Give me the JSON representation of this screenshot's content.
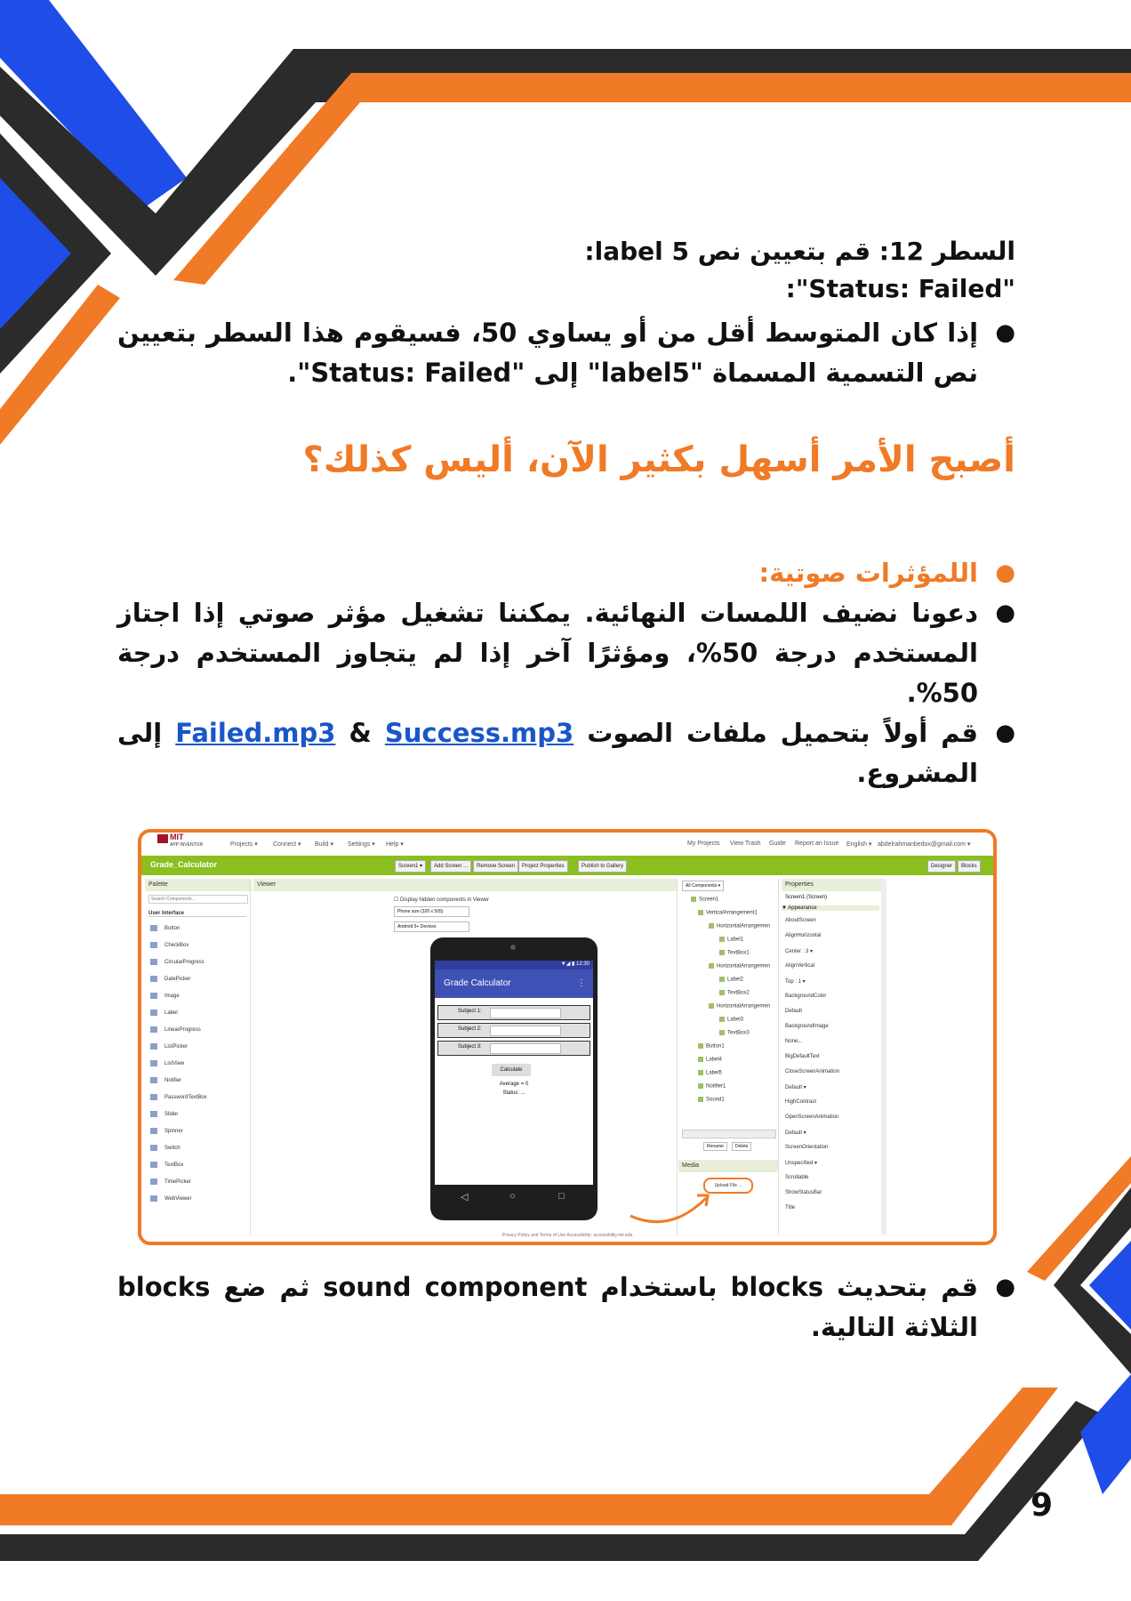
{
  "line12": {
    "heading_1": "السطر 12: قم بتعيين نص label 5:",
    "heading_2": "\"Status: Failed\":",
    "bullet": "إذا كان المتوسط أقل من أو يساوي 50، فسيقوم هذا السطر بتعيين نص التسمية المسماة \"label5\" إلى \"Status: Failed\"."
  },
  "subheading": "أصبح الأمر أسهل بكثير الآن، أليس كذلك؟",
  "sound_section": {
    "title": "اللمؤثرات صوتية:",
    "bullet_1": "دعونا نضيف اللمسات النهائية. يمكننا تشغيل مؤثر صوتي إذا اجتاز المستخدم درجة 50%، ومؤثرًا آخر إذا لم يتجاوز المستخدم درجة 50%.",
    "bullet_2_before": "قم أولاً بتحميل ملفات الصوت ",
    "link_failed": "Failed.mp3",
    "amp": " & ",
    "link_success": "Success.mp3",
    "bullet_2_after": " إلى المشروع."
  },
  "final_bullet": "قم بتحديث blocks باستخدام sound component ثم ضع blocks الثلاثة التالية.",
  "page_number": "9",
  "colors": {
    "accent_orange": "#f07a26",
    "accent_blue": "#1f4de8",
    "dark": "#2b2b2b",
    "link": "#1a56c9"
  },
  "screenshot": {
    "logo_top": "MIT",
    "logo_bottom": "APP INVENTOR",
    "menus": [
      "Projects ▾",
      "Connect ▾",
      "Build ▾",
      "Settings ▾",
      "Help ▾"
    ],
    "right_menus": [
      "My Projects",
      "View Trash",
      "Guide",
      "Report an Issue",
      "English ▾",
      "abdelrahmanbedox@gmail.com ▾"
    ],
    "project_name": "Grade_Calculator",
    "toolbar_buttons": [
      "Screen1 ▾",
      "Add Screen ...",
      "Remove Screen",
      "Project Properties",
      "Publish to Gallery"
    ],
    "mode_buttons": [
      "Designer",
      "Blocks"
    ],
    "palette_title": "Palette",
    "search_placeholder": "Search Components...",
    "palette_group": "User Interface",
    "palette_items": [
      "Button",
      "CheckBox",
      "CircularProgress",
      "DatePicker",
      "Image",
      "Label",
      "LinearProgress",
      "ListPicker",
      "ListView",
      "Notifier",
      "PasswordTextBox",
      "Slider",
      "Spinner",
      "Switch",
      "TextBox",
      "TimePicker",
      "WebViewer"
    ],
    "viewer_title": "Viewer",
    "hidden_checkbox": "Display hidden components in Viewer",
    "phone_size": "Phone size (320 x 505)",
    "device": "Android 5+ Devices",
    "status_time": "▼◢ ▮ 12:30",
    "app_title": "Grade Calculator",
    "subjects": [
      "Subject 1:",
      "Subject 2:",
      "Subject 3:"
    ],
    "calculate": "Calculate",
    "average": "Average = 0",
    "status": "Status: ...",
    "components_dropdown": "All Components ▾",
    "tree": [
      "Screen1",
      "VerticalArrangement1",
      "HorizontalArrangemen",
      "Label1",
      "TextBox1",
      "HorizontalArrangemen",
      "Label2",
      "TextBox2",
      "HorizontalArrangemen",
      "Label3",
      "TextBox3",
      "Button1",
      "Label4",
      "Label5",
      "Notifier1",
      "Sound1"
    ],
    "rename": "Rename",
    "delete": "Delete",
    "media": "Media",
    "upload": "Upload File ...",
    "properties_title": "Properties",
    "properties_screen": "Screen1 (Screen)",
    "appearance": "▼ Appearance",
    "props": [
      "AboutScreen",
      "AlignHorizontal",
      "Center : 3 ▾",
      "AlignVertical",
      "Top : 1 ▾",
      "BackgroundColor",
      "Default",
      "BackgroundImage",
      "None...",
      "BigDefaultText",
      "CloseScreenAnimation",
      "Default ▾",
      "HighContrast",
      "OpenScreenAnimation",
      "Default ▾",
      "ScreenOrientation",
      "Unspecified ▾",
      "Scrollable",
      "ShowStatusBar",
      "Title"
    ],
    "footer": "Privacy Policy and Terms of Use      Accessibility: accessibility.mit.edu"
  }
}
